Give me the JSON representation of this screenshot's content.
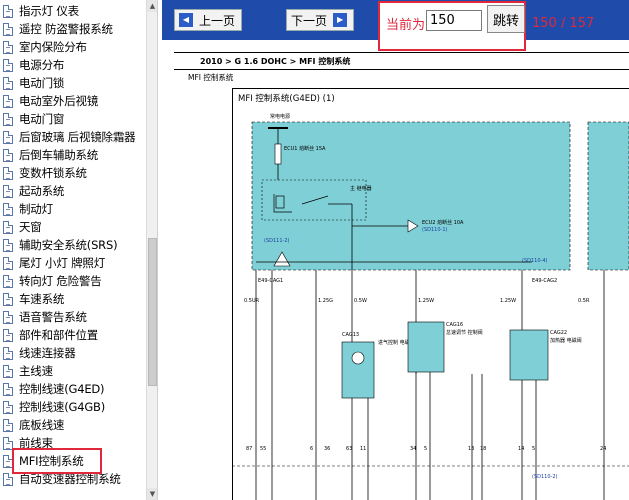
{
  "sidebar": {
    "items": [
      "指示灯 仪表",
      "遥控 防盗警报系统",
      "室内保险分布",
      "电源分布",
      "电动门锁",
      "电动室外后视镜",
      "电动门窗",
      "后窗玻璃 后视镜除霜器",
      "后倒车辅助系统",
      "变数杆锁系统",
      "起动系统",
      "制动灯",
      "天窗",
      "辅助安全系统(SRS)",
      "尾灯 小灯 牌照灯",
      "转向灯 危险警告",
      "车速系统",
      "语音警告系统",
      "部件和部件位置",
      "线速连接器",
      "主线速",
      "控制线速(G4ED)",
      "控制线速(G4GB)",
      "底板线速",
      "前线束",
      "MFI控制系统",
      "自动变速器控制系统"
    ],
    "selected_index": 25
  },
  "toolbar": {
    "prev_label": "上一页",
    "next_label": "下一页",
    "current_label": "当前为",
    "page_value": "150",
    "jump_label": "跳转",
    "page_count": "150 / 157"
  },
  "document": {
    "breadcrumb": "2010 > G 1.6 DOHC > MFI 控制系统",
    "section_label": "MFI 控制系统",
    "diagram_title": "MFI 控制系统(G4ED) (1)"
  },
  "diagram": {
    "top_label": "常电电源",
    "fuse_label": "ECU1 熔断丝 15A",
    "relay_label": "主 继电器",
    "fuse2_label": "ECU2 熔断丝 10A",
    "wire_labels": [
      "0.5UR",
      "1.25G",
      "0.5W",
      "1.25W",
      "1.25W",
      "0.5R"
    ],
    "connectors": [
      "CAG13",
      "CAG16",
      "CAG22",
      "E49-CAG1",
      "E49-CAG2"
    ],
    "components": [
      "进气控制 电磁阀",
      "怠速调节 控制阀",
      "加热器 电磁阀"
    ],
    "bottom_numbers": [
      "87",
      "55",
      "6",
      "36",
      "63",
      "11",
      "34",
      "5",
      "13",
      "18",
      "14",
      "5",
      "24"
    ],
    "ref_labels": [
      "(SD110-1)",
      "(SD111-2)",
      "(SD110-4)",
      "(SD110-2)"
    ]
  },
  "colors": {
    "toolbar_bg": "#1f4cab",
    "highlight": "#e0283c",
    "diagram_fill": "#7fd0d6",
    "text_blue": "#1a3fa0"
  },
  "icons": {
    "tree_item": "document-icon",
    "prev": "arrow-left-icon",
    "next": "arrow-right-icon"
  }
}
